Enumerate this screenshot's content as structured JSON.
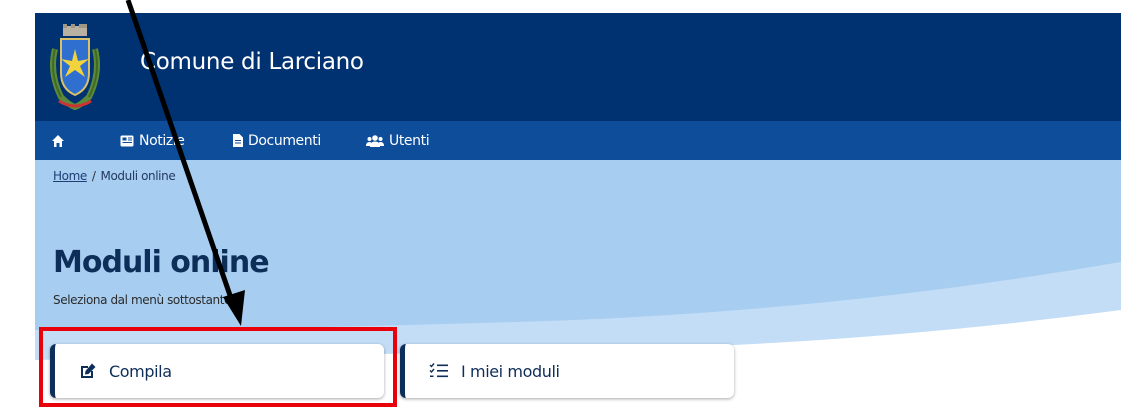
{
  "header": {
    "site_title": "Comune di Larciano"
  },
  "nav": {
    "items": [
      {
        "label": ""
      },
      {
        "label": "Notizie"
      },
      {
        "label": "Documenti"
      },
      {
        "label": "Utenti"
      }
    ]
  },
  "breadcrumb": {
    "home": "Home",
    "separator": "/",
    "current": "Moduli online"
  },
  "main": {
    "title": "Moduli online",
    "subtitle": "Seleziona dal menù sottostante",
    "cards": [
      {
        "label": "Compila",
        "icon": "edit-icon"
      },
      {
        "label": "I miei moduli",
        "icon": "checklist-icon"
      }
    ]
  },
  "colors": {
    "header_bg": "#003272",
    "nav_bg": "#0d4d9a",
    "hero_bg": "#a7cdf1",
    "title": "#0e2e5a",
    "highlight": "#e8000b"
  }
}
